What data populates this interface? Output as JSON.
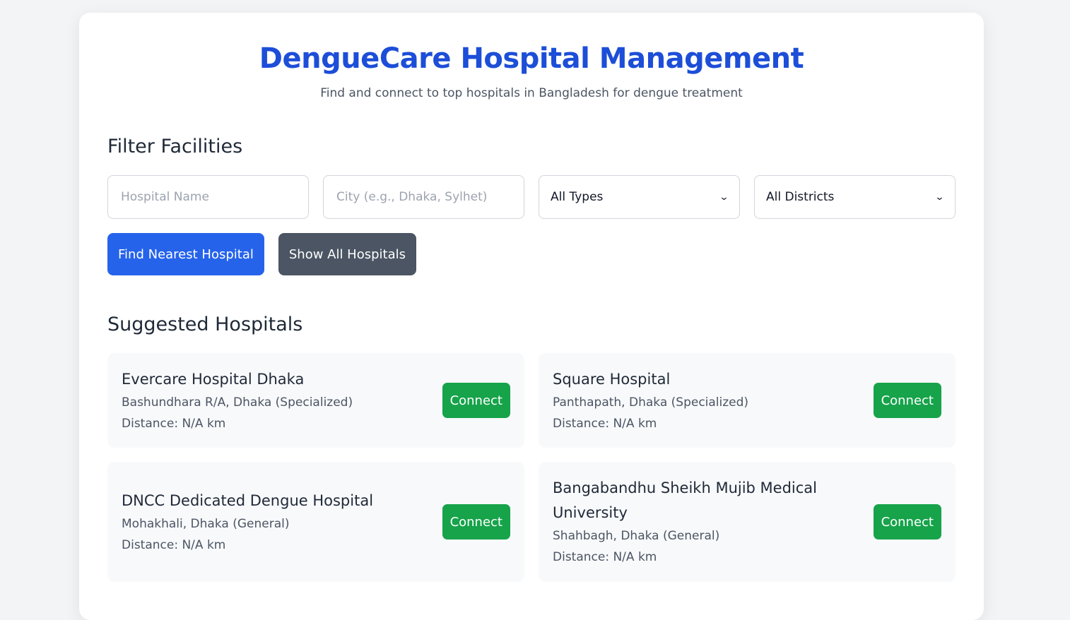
{
  "header": {
    "title": "DengueCare Hospital Management",
    "subtitle": "Find and connect to top hospitals in Bangladesh for dengue treatment"
  },
  "filters": {
    "section_title": "Filter Facilities",
    "hospital_name_placeholder": "Hospital Name",
    "city_placeholder": "City (e.g., Dhaka, Sylhet)",
    "type_selected": "All Types",
    "district_selected": "All Districts",
    "find_nearest_label": "Find Nearest Hospital",
    "show_all_label": "Show All Hospitals"
  },
  "suggested": {
    "section_title": "Suggested Hospitals",
    "hospitals": [
      {
        "name": "Evercare Hospital Dhaka",
        "location": "Bashundhara R/A, Dhaka (Specialized)",
        "distance": "Distance: N/A km",
        "action": "Connect"
      },
      {
        "name": "Square Hospital",
        "location": "Panthapath, Dhaka (Specialized)",
        "distance": "Distance: N/A km",
        "action": "Connect"
      },
      {
        "name": "DNCC Dedicated Dengue Hospital",
        "location": "Mohakhali, Dhaka (General)",
        "distance": "Distance: N/A km",
        "action": "Connect"
      },
      {
        "name": "Bangabandhu Sheikh Mujib Medical University",
        "location": "Shahbagh, Dhaka (General)",
        "distance": "Distance: N/A km",
        "action": "Connect"
      }
    ]
  },
  "colors": {
    "brand": "#1d4ed8",
    "primary_button": "#2563eb",
    "secondary_button": "#4b5563",
    "connect_button": "#16a34a"
  }
}
